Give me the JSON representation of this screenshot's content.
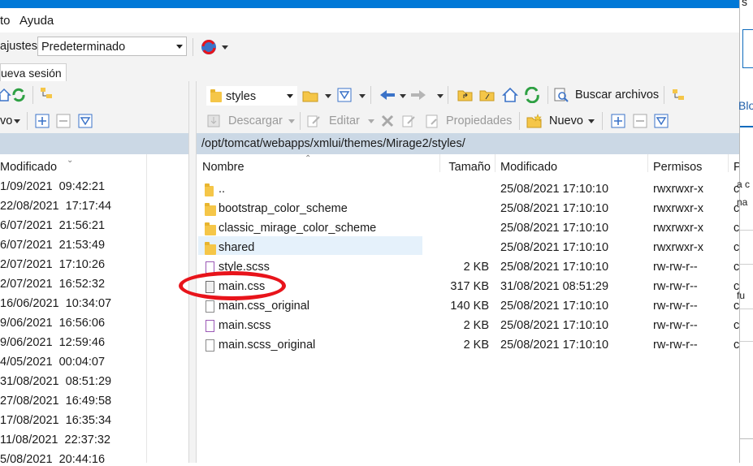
{
  "menu": {
    "item1": "to",
    "item2": "Ayuda"
  },
  "toolbar": {
    "settings_label": "ajustes",
    "settings_value": "Predeterminado"
  },
  "tabs": {
    "new_session": "ueva sesión"
  },
  "left_toolbar": {
    "new_label": "vo"
  },
  "right_toolbar": {
    "folder_combo": "styles",
    "find_files": "Buscar archivos",
    "download": "Descargar",
    "edit": "Editar",
    "properties": "Propiedades",
    "new": "Nuevo"
  },
  "right_path": "/opt/tomcat/webapps/xmlui/themes/Mirage2/styles/",
  "left_panel": {
    "header_modified": "Modificado",
    "rows": [
      "1/09/2021  09:42:21",
      "22/08/2021  17:17:44",
      "6/07/2021  21:56:21",
      "6/07/2021  21:53:49",
      "2/07/2021  17:10:26",
      "2/07/2021  16:52:32",
      "16/06/2021  10:34:07",
      "9/06/2021  16:56:06",
      "9/06/2021  12:59:46",
      "4/05/2021  00:04:07",
      "31/08/2021  08:51:29",
      "27/08/2021  16:49:58",
      "17/08/2021  16:35:34",
      "11/08/2021  22:37:32",
      "5/08/2021  20:44:16"
    ]
  },
  "right_panel": {
    "headers": {
      "name": "Nombre",
      "size": "Tamaño",
      "modified": "Modificado",
      "perms": "Permisos",
      "owner": "P"
    },
    "rows": [
      {
        "name": "..",
        "size": "",
        "modified": "25/08/2021 17:10:10",
        "perms": "rwxrwxr-x",
        "owner": "c",
        "type": "parent"
      },
      {
        "name": "bootstrap_color_scheme",
        "size": "",
        "modified": "25/08/2021 17:10:10",
        "perms": "rwxrwxr-x",
        "owner": "c",
        "type": "folder"
      },
      {
        "name": "classic_mirage_color_scheme",
        "size": "",
        "modified": "25/08/2021 17:10:10",
        "perms": "rwxrwxr-x",
        "owner": "c",
        "type": "folder"
      },
      {
        "name": "shared",
        "size": "",
        "modified": "25/08/2021 17:10:10",
        "perms": "rwxrwxr-x",
        "owner": "c",
        "type": "folder"
      },
      {
        "name": "style.scss",
        "size": "2 KB",
        "modified": "25/08/2021 17:10:10",
        "perms": "rw-rw-r--",
        "owner": "c",
        "type": "scss"
      },
      {
        "name": "main.css",
        "size": "317 KB",
        "modified": "31/08/2021 08:51:29",
        "perms": "rw-rw-r--",
        "owner": "c",
        "type": "css"
      },
      {
        "name": "main.css_original",
        "size": "140 KB",
        "modified": "25/08/2021 17:10:10",
        "perms": "rw-rw-r--",
        "owner": "c",
        "type": "file"
      },
      {
        "name": "main.scss",
        "size": "2 KB",
        "modified": "25/08/2021 17:10:10",
        "perms": "rw-rw-r--",
        "owner": "c",
        "type": "scss"
      },
      {
        "name": "main.scss_original",
        "size": "2 KB",
        "modified": "25/08/2021 17:10:10",
        "perms": "rw-rw-r--",
        "owner": "c",
        "type": "file"
      }
    ]
  },
  "edge_texts": {
    "top": "s",
    "blo": "Blo",
    "a1": "a c",
    "a2": "na",
    "fu": "fu"
  },
  "colors": {
    "accent": "#0078d7",
    "path_bar": "#cbd8e5",
    "selected_row": "#e5f1fb",
    "highlight_ellipse": "#e8141b"
  }
}
